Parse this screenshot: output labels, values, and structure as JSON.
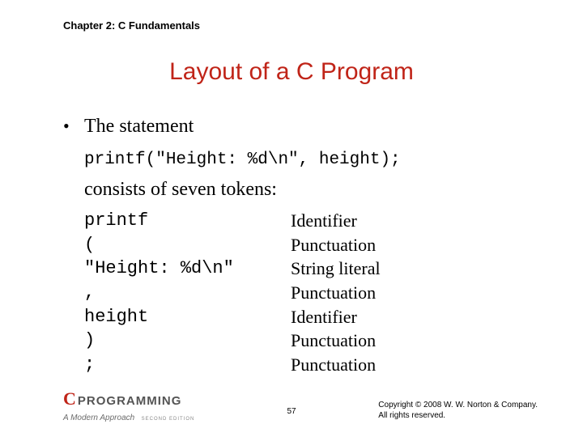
{
  "chapter": "Chapter 2: C Fundamentals",
  "title": "Layout of a C Program",
  "bullet": "•",
  "line1": "The statement",
  "code": "printf(\"Height: %d\\n\", height);",
  "line2": "consists of seven tokens:",
  "tokens": [
    {
      "tok": "printf",
      "cat": "Identifier"
    },
    {
      "tok": "(",
      "cat": "Punctuation"
    },
    {
      "tok": "\"Height: %d\\n\"",
      "cat": "String literal"
    },
    {
      "tok": ",",
      "cat": "Punctuation"
    },
    {
      "tok": "height",
      "cat": "Identifier"
    },
    {
      "tok": ")",
      "cat": "Punctuation"
    },
    {
      "tok": ";",
      "cat": "Punctuation"
    }
  ],
  "logo": {
    "c": "C",
    "prog": "PROGRAMMING",
    "sub": "A Modern Approach",
    "ed": "SECOND EDITION"
  },
  "page": "57",
  "copyright1": "Copyright © 2008 W. W. Norton & Company.",
  "copyright2": "All rights reserved."
}
